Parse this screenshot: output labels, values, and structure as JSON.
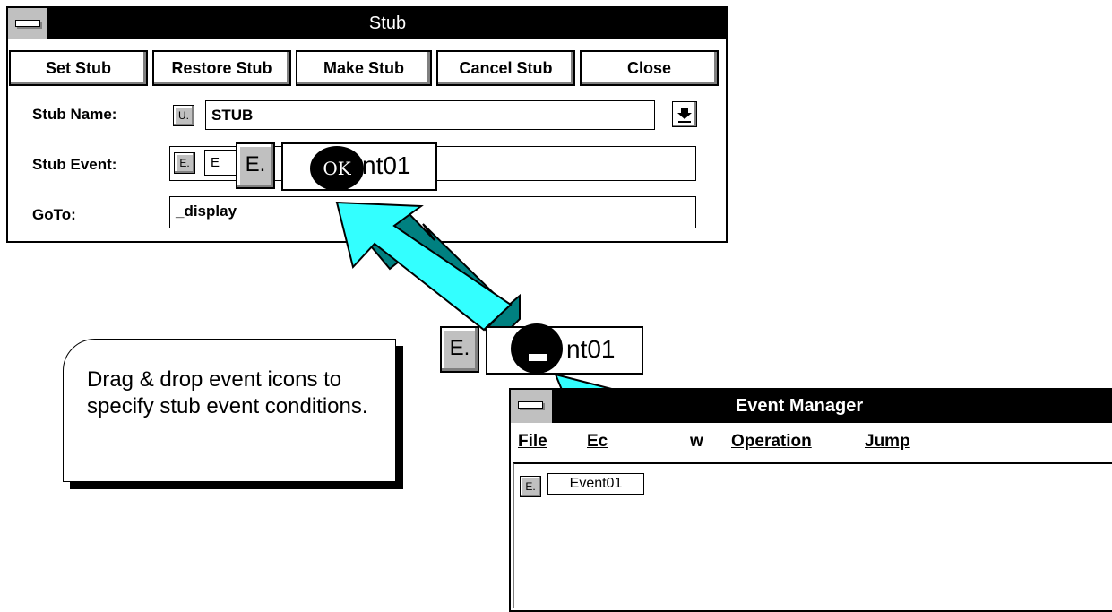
{
  "stub_window": {
    "title": "Stub",
    "buttons": [
      "Set Stub",
      "Restore Stub",
      "Make Stub",
      "Cancel Stub",
      "Close"
    ],
    "stub_name_label": "Stub Name:",
    "stub_name_value": "STUB",
    "stub_event_label": "Stub Event:",
    "stub_event_value": "E",
    "goto_label": "GoTo:",
    "goto_value": "_display",
    "u_icon_text": "U.",
    "e_icon_text": "E."
  },
  "drag_top": {
    "icon_text": "E.",
    "event_text": "nt01",
    "cursor_text": "OK"
  },
  "drag_bottom": {
    "icon_text": "E.",
    "event_text": "nt01"
  },
  "callout": {
    "text": "Drag & drop event icons to specify stub event conditions."
  },
  "event_manager": {
    "title": "Event Manager",
    "menu": [
      "File",
      "Ec",
      "w",
      "Operation",
      "Jump"
    ],
    "event_icon_text": "E.",
    "event_item": "Event01"
  },
  "colors": {
    "arrow": "#33ffff",
    "arrow_side": "#008080",
    "titlebar": "#000000",
    "button_face": "#c0c0c0"
  }
}
